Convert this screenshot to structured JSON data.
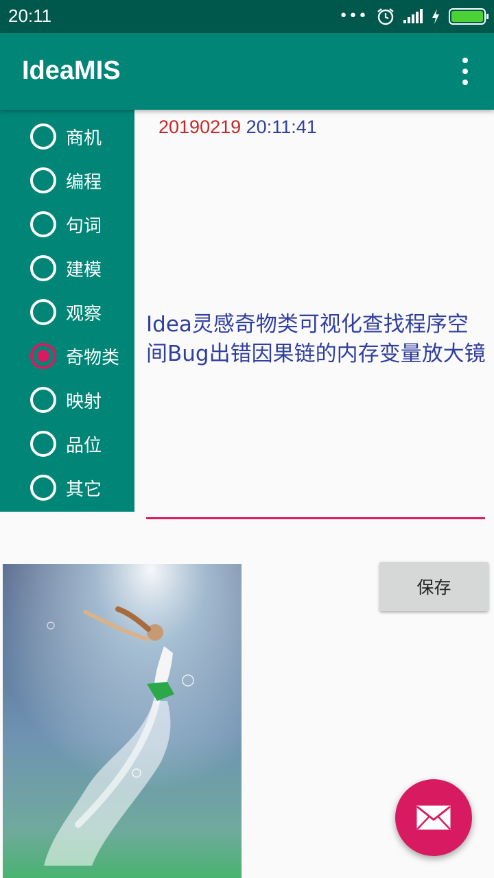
{
  "status_bar": {
    "time": "20:11",
    "more_indicator": "•••",
    "icons": [
      "alarm-icon",
      "signal-icon",
      "charging-icon",
      "battery-icon"
    ],
    "battery_color": "#4cd137"
  },
  "app_bar": {
    "title": "IdeaMIS",
    "menu_icon": "overflow-menu-icon",
    "color": "#008577"
  },
  "categories": [
    {
      "label": "商机",
      "checked": false
    },
    {
      "label": "编程",
      "checked": false
    },
    {
      "label": "句词",
      "checked": false
    },
    {
      "label": "建模",
      "checked": false
    },
    {
      "label": "观察",
      "checked": false
    },
    {
      "label": "奇物类",
      "checked": true
    },
    {
      "label": "映射",
      "checked": false
    },
    {
      "label": "品位",
      "checked": false
    },
    {
      "label": "其它",
      "checked": false
    }
  ],
  "entry": {
    "date": "20190219",
    "time": "20:11:41",
    "text": "Idea灵感奇物类可视化查找程序空间Bug出错因果链的内存变量放大镜"
  },
  "save_button": {
    "label": "保存"
  },
  "fab": {
    "icon": "mail-icon",
    "color": "#d81b60"
  },
  "colors": {
    "status_bar": "#00574b",
    "primary": "#008577",
    "accent": "#d81b60",
    "text_blue": "#303f9f",
    "date_red": "#c62828"
  }
}
